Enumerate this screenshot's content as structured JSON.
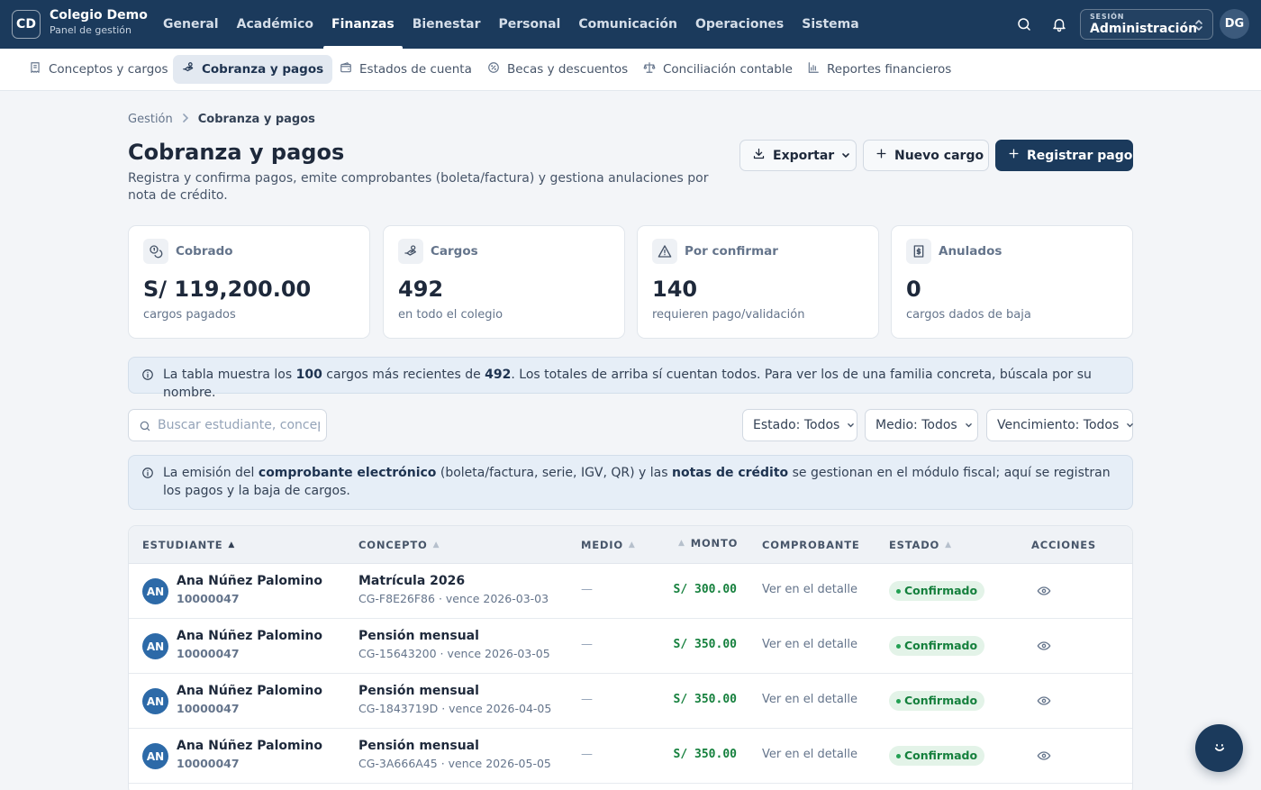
{
  "brand": {
    "initials": "CD",
    "name": "Colegio Demo",
    "subtitle": "Panel de gestión"
  },
  "main_nav": [
    "General",
    "Académico",
    "Finanzas",
    "Bienestar",
    "Personal",
    "Comunicación",
    "Operaciones",
    "Sistema"
  ],
  "main_nav_active": "Finanzas",
  "session": {
    "label": "SESIÓN",
    "value": "Administración"
  },
  "user_initials": "DG",
  "sub_nav": [
    {
      "label": "Conceptos y cargos",
      "icon": "receipt-icon",
      "active": false
    },
    {
      "label": "Cobranza y pagos",
      "icon": "hand-coins-icon",
      "active": true
    },
    {
      "label": "Estados de cuenta",
      "icon": "wallet-icon",
      "active": false
    },
    {
      "label": "Becas y descuentos",
      "icon": "percent-icon",
      "active": false
    },
    {
      "label": "Conciliación contable",
      "icon": "scale-icon",
      "active": false
    },
    {
      "label": "Reportes financieros",
      "icon": "bar-chart-icon",
      "active": false
    }
  ],
  "breadcrumb": {
    "parent": "Gestión",
    "current": "Cobranza y pagos"
  },
  "page": {
    "title": "Cobranza y pagos",
    "description": "Registra y confirma pagos, emite comprobantes (boleta/factura) y gestiona anulaciones por nota de crédito."
  },
  "actions": {
    "export": "Exportar",
    "new_charge": "Nuevo cargo",
    "register_payment": "Registrar pago"
  },
  "stats": [
    {
      "label": "Cobrado",
      "value": "S/ 119,200.00",
      "sub": "cargos pagados",
      "icon": "coins-icon"
    },
    {
      "label": "Cargos",
      "value": "492",
      "sub": "en todo el colegio",
      "icon": "hand-coins-icon"
    },
    {
      "label": "Por confirmar",
      "value": "140",
      "sub": "requieren pago/validación",
      "icon": "warning-icon"
    },
    {
      "label": "Anulados",
      "value": "0",
      "sub": "cargos dados de baja",
      "icon": "cancelled-receipt-icon"
    }
  ],
  "notice_table": {
    "t1": "La tabla muestra los ",
    "b1": "100",
    "t2": " cargos más recientes de ",
    "b2": "492",
    "t3": ". Los totales de arriba sí cuentan todos. Para ver los de una familia concreta, búscala por su nombre."
  },
  "search": {
    "placeholder": "Buscar estudiante, concepto o código",
    "value": ""
  },
  "filters": {
    "estado": "Estado: Todos",
    "medio": "Medio: Todos",
    "vencimiento": "Vencimiento: Todos"
  },
  "notice_fiscal": {
    "t1": "La emisión del ",
    "b1": "comprobante electrónico",
    "t2": " (boleta/factura, serie, IGV, QR) y las ",
    "b2": "notas de crédito",
    "t3": " se gestionan en el módulo fiscal; aquí se registran los pagos y la baja de cargos."
  },
  "table": {
    "columns": {
      "student": "ESTUDIANTE",
      "concept": "CONCEPTO",
      "medium": "MEDIO",
      "amount": "MONTO",
      "receipt": "COMPROBANTE",
      "status": "ESTADO",
      "actions": "ACCIONES"
    },
    "rows": [
      {
        "initials": "AN",
        "name": "Ana Núñez Palomino",
        "id": "10000047",
        "concept": "Matrícula 2026",
        "code": "CG-F8E26F86 · vence 2026-03-03",
        "medium": "—",
        "amount": "S/ 300.00",
        "receipt": "Ver en el detalle",
        "status": "Confirmado"
      },
      {
        "initials": "AN",
        "name": "Ana Núñez Palomino",
        "id": "10000047",
        "concept": "Pensión mensual",
        "code": "CG-15643200 · vence 2026-03-05",
        "medium": "—",
        "amount": "S/ 350.00",
        "receipt": "Ver en el detalle",
        "status": "Confirmado"
      },
      {
        "initials": "AN",
        "name": "Ana Núñez Palomino",
        "id": "10000047",
        "concept": "Pensión mensual",
        "code": "CG-1843719D · vence 2026-04-05",
        "medium": "—",
        "amount": "S/ 350.00",
        "receipt": "Ver en el detalle",
        "status": "Confirmado"
      },
      {
        "initials": "AN",
        "name": "Ana Núñez Palomino",
        "id": "10000047",
        "concept": "Pensión mensual",
        "code": "CG-3A666A45 · vence 2026-05-05",
        "medium": "—",
        "amount": "S/ 350.00",
        "receipt": "Ver en el detalle",
        "status": "Confirmado"
      }
    ]
  },
  "colors": {
    "primary": "#1b3a5c",
    "success": "#15803d",
    "success_bg": "#e3f3e8",
    "info_bg": "#e6eef7"
  }
}
